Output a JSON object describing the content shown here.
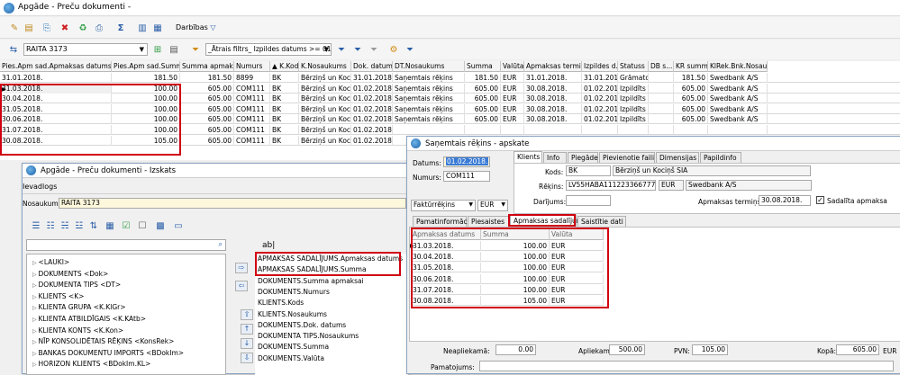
{
  "main_window": {
    "title": "Apgāde - Preču dokumenti -"
  },
  "toolbar": {
    "actions_label": "Darbības",
    "actions_chevron": "▽"
  },
  "filterbar": {
    "doc_selector_value": "RAITA 3173",
    "quick_filter_value": "_Ātrais filtrs_ Izpildes datums >= 01"
  },
  "main_grid": {
    "columns": [
      "Pies.Apm sad.Apmaksas datums",
      "Pies.Apm sad.Summa",
      "Summa apmaksai",
      "Numurs",
      "▲ K.Kods",
      "K.Nosaukums",
      "Dok. datums",
      "DT.Nosaukums",
      "Summa",
      "Valūta",
      "Apmaksas termiņš",
      "Izpildes d...",
      "Statuss",
      "DB s...",
      "KR summa",
      "KlRek.Bnk.Nosaukums"
    ],
    "rows": [
      [
        "31.01.2018.",
        "181.50",
        "181.50",
        "8899",
        "BK",
        "Bērziņš un Kociņš",
        "31.01.2018.",
        "Saņemtais rēķins",
        "181.50",
        "EUR",
        "31.01.2018.",
        "31.01.2018.",
        "Grāmatots",
        "",
        "181.50",
        "Swedbank A/S"
      ],
      [
        "31.03.2018.",
        "100.00",
        "605.00",
        "COM111",
        "BK",
        "Bērziņš un Kociņš",
        "01.02.2018.",
        "Saņemtais rēķins",
        "605.00",
        "EUR",
        "30.08.2018.",
        "01.02.2018.",
        "Izpildīts",
        "",
        "605.00",
        "Swedbank A/S"
      ],
      [
        "30.04.2018.",
        "100.00",
        "605.00",
        "COM111",
        "BK",
        "Bērziņš un Kociņš",
        "01.02.2018.",
        "Saņemtais rēķins",
        "605.00",
        "EUR",
        "30.08.2018.",
        "01.02.2018.",
        "Izpildīts",
        "",
        "605.00",
        "Swedbank A/S"
      ],
      [
        "31.05.2018.",
        "100.00",
        "605.00",
        "COM111",
        "BK",
        "Bērziņš un Kociņš",
        "01.02.2018.",
        "Saņemtais rēķins",
        "605.00",
        "EUR",
        "30.08.2018.",
        "01.02.2018.",
        "Izpildīts",
        "",
        "605.00",
        "Swedbank A/S"
      ],
      [
        "30.06.2018.",
        "100.00",
        "605.00",
        "COM111",
        "BK",
        "Bērziņš un Kociņš",
        "01.02.2018.",
        "Saņemtais rēķins",
        "605.00",
        "EUR",
        "30.08.2018.",
        "01.02.2018.",
        "Izpildīts",
        "",
        "605.00",
        "Swedbank A/S"
      ],
      [
        "31.07.2018.",
        "100.00",
        "605.00",
        "COM111",
        "BK",
        "Bērziņš un Kociņš",
        "01.02.2018.",
        "",
        "",
        "",
        "",
        "",
        "",
        "",
        "",
        ""
      ],
      [
        "30.08.2018.",
        "105.00",
        "605.00",
        "COM111",
        "BK",
        "Bērziņš un Kociņš",
        "01.02.2018.",
        "",
        "",
        "",
        "",
        "",
        "",
        "",
        "",
        ""
      ]
    ]
  },
  "layout_window": {
    "title": "Apgāde - Preču dokumenti - Izskats",
    "section_label": "Ievadlogs",
    "name_label": "Nosaukums:",
    "name_value": "RAITA 3173",
    "search_placeholder": "",
    "left_fields": [
      "<LAUKI>",
      "DOKUMENTS <Dok>",
      "DOKUMENTA TIPS <DT>",
      "KLIENTS <K>",
      "KLIENTA GRUPA <K.KlGr>",
      "KLIENTA ATBILDĪGAIS <K.KAtb>",
      "KLIENTA KONTS <K.Kon>",
      "NĪP KONSOLIDĒTAIS RĒĶINS <KonsRek>",
      "BANKAS DOKUMENTU IMPORTS <BDokIm>",
      "HORIZON KLIENTS <BDokIm.KL>"
    ],
    "ab_label": "ab|",
    "right_fields": [
      "APMAKSAS SADALĪJUMS.Apmaksas datums",
      "APMAKSAS SADALĪJUMS.Summa",
      "DOKUMENTS.Summa apmaksai",
      "DOKUMENTS.Numurs",
      "KLIENTS.Kods",
      "KLIENTS.Nosaukums",
      "DOKUMENTS.Dok. datums",
      "DOKUMENTA TIPS.Nosaukums",
      "DOKUMENTS.Summa",
      "DOKUMENTS.Valūta"
    ]
  },
  "invoice_window": {
    "title": "Saņemtais rēķins - apskate",
    "datums_label": "Datums:",
    "datums_value": "01.02.2018.",
    "numurs_label": "Numurs:",
    "numurs_value": "COM111",
    "doc_type": "Faktūrrēķins",
    "currency": "EUR",
    "tabs_top": [
      "Klients",
      "Info",
      "Piegāde",
      "Pievienotie faili",
      "Dimensijas",
      "Papildinfo"
    ],
    "kods_label": "Kods:",
    "kods_value": "BK",
    "kods_name": "Bērziņš un Kociņš SIA",
    "rekins_label": "Rēķins:",
    "rekins_value": "LV55HABA1112233667777",
    "rekins_currency": "EUR",
    "rekins_bank": "Swedbank A/S",
    "darijums_label": "Darījums:",
    "termins_label": "Apmaksas termiņš:",
    "termins_value": "30.08.2018.",
    "sadalita_label": "Sadalīta apmaksa",
    "tabs_bottom": [
      "Pamatinformācija",
      "Piesaistes",
      "Apmaksas sadalījums",
      "Saistītie dati"
    ],
    "split_columns": [
      "Apmaksas datums",
      "Summa",
      "Valūta"
    ],
    "split_rows": [
      [
        "31.03.2018.",
        "100.00",
        "EUR"
      ],
      [
        "30.04.2018.",
        "100.00",
        "EUR"
      ],
      [
        "31.05.2018.",
        "100.00",
        "EUR"
      ],
      [
        "30.06.2018.",
        "100.00",
        "EUR"
      ],
      [
        "31.07.2018.",
        "100.00",
        "EUR"
      ],
      [
        "30.08.2018.",
        "105.00",
        "EUR"
      ]
    ],
    "neaplikama_label": "Neapliekamā:",
    "neaplikama_value": "0.00",
    "aplikama_label": "Apliekamā:",
    "aplikama_value": "500.00",
    "pvn_label": "PVN:",
    "pvn_value": "105.00",
    "kopa_label": "Kopā:",
    "kopa_value": "605.00",
    "kopa_currency": "EUR",
    "pamatojums_label": "Pamatojums:"
  },
  "colors": {
    "highlight_red": "#d00010",
    "title_blue": "#2a5ea8"
  }
}
